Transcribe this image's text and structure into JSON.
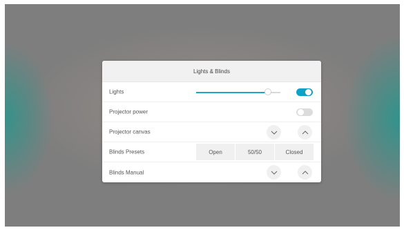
{
  "panel": {
    "title": "Lights & Blinds"
  },
  "rows": {
    "lights": {
      "label": "Lights",
      "level": 0.85,
      "toggle_on": true
    },
    "projector_power": {
      "label": "Projector power",
      "toggle_on": false
    },
    "projector_canvas": {
      "label": "Projector canvas",
      "down_icon": "chevron-down-icon",
      "up_icon": "chevron-up-icon"
    },
    "blinds_presets": {
      "label": "Blinds Presets",
      "options": [
        "Open",
        "50/50",
        "Closed"
      ]
    },
    "blinds_manual": {
      "label": "Blinds Manual",
      "down_icon": "chevron-down-icon",
      "up_icon": "chevron-up-icon"
    }
  },
  "colors": {
    "accent": "#0fa1c6",
    "toggle_off": "#dcdcdc"
  }
}
